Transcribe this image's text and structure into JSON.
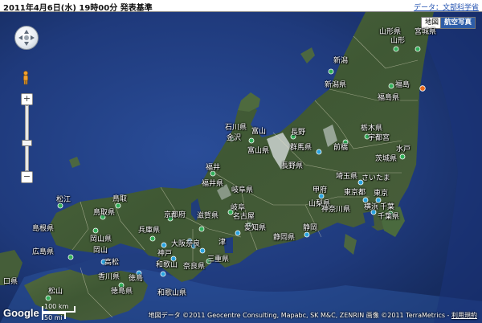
{
  "header": {
    "title": "2011年4月6日(水) 19時00分 発表基準",
    "source_link": "データ：文部科学省"
  },
  "map_type": {
    "map": "地図",
    "satellite": "航空写真"
  },
  "controls": {
    "zoom_in": "+",
    "zoom_out": "−"
  },
  "labels": {
    "yamagata": "山形県",
    "miyagi": "宮城県",
    "yamagata_city": "山形",
    "niigata": "新潟",
    "niigata_pref": "新潟県",
    "fukushima": "福島",
    "fukushima_pref": "福島県",
    "ishikawa": "石川県",
    "toyama": "富山",
    "nagano_city": "長野",
    "tochigi": "栃木県",
    "utsunomiya": "宇都宮",
    "kanazawa": "金沢",
    "toyama_pref": "富山県",
    "gunma": "群馬県",
    "maebashi": "前橋",
    "mito": "水戸",
    "ibaraki": "茨城県",
    "nagano_pref": "長野県",
    "fukui": "福井",
    "fukui_pref": "福井県",
    "saitama": "埼玉県",
    "saitama_city": "さいたま",
    "matsue": "松江",
    "tottori": "鳥取",
    "gifu": "岐阜県",
    "kofu": "甲府",
    "tokyo": "東京都",
    "tokyo_city": "東京",
    "tottori_pref": "鳥取県",
    "kyoto_pref": "京都府",
    "shiga": "滋賀県",
    "gifu_city": "岐阜",
    "yamanashi": "山梨県",
    "chiba": "千葉",
    "shimane": "島根県",
    "kanagawa": "神奈川県",
    "yokohama": "横浜",
    "hyogo": "兵庫県",
    "nagoya": "名古屋",
    "aichi": "愛知県",
    "chiba_pref": "千葉県",
    "okayama_pref": "岡山県",
    "okayama": "岡山",
    "kobe": "神戸",
    "osaka": "大阪",
    "nara": "奈良",
    "tsu": "津",
    "shizuoka_pref": "静岡県",
    "shizuoka": "静岡",
    "hiroshima_pref": "広島県",
    "takamatsu": "高松",
    "mie": "三重県",
    "wakayama": "和歌山",
    "nara_pref": "奈良県",
    "kagawa": "香川県",
    "tokushima_city": "徳島",
    "tokushima_pref": "徳島県",
    "wakayama_pref": "和歌山県",
    "yamaguchi_pref": "口県",
    "matsuyama": "松山"
  },
  "scale": {
    "km": "100 km",
    "mi": "50 mi"
  },
  "logo": "Google",
  "attribution": {
    "text": "地図データ ©2011 Geocentre Consulting, Mapabc, SK M&C, ZENRIN 画像 ©2011 TerraMetrics -",
    "terms": "利用規約"
  },
  "colors": {
    "marker_green": "#33b05a",
    "marker_blue": "#2aa4e0",
    "marker_orange": "#e86a1c",
    "sea": "#1d3a78",
    "land": "#46603a"
  }
}
